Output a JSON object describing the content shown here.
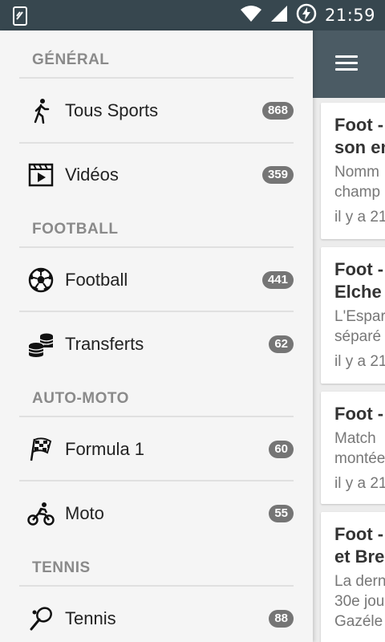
{
  "status_bar": {
    "time": "21:59"
  },
  "drawer": {
    "sections": [
      {
        "title": "GÉNÉRAL",
        "items": [
          {
            "label": "Tous Sports",
            "count": "868",
            "icon": "walking-person-icon"
          },
          {
            "label": "Vidéos",
            "count": "359",
            "icon": "video-play-icon"
          }
        ]
      },
      {
        "title": "FOOTBALL",
        "items": [
          {
            "label": "Football",
            "count": "441",
            "icon": "soccer-ball-icon"
          },
          {
            "label": "Transferts",
            "count": "62",
            "icon": "coins-icon"
          }
        ]
      },
      {
        "title": "AUTO-MOTO",
        "items": [
          {
            "label": "Formula 1",
            "count": "60",
            "icon": "checkered-flag-icon"
          },
          {
            "label": "Moto",
            "count": "55",
            "icon": "motorbike-icon"
          }
        ]
      },
      {
        "title": "TENNIS",
        "items": [
          {
            "label": "Tennis",
            "count": "88",
            "icon": "tennis-racket-icon"
          }
        ]
      }
    ]
  },
  "feed": {
    "cards": [
      {
        "title1": "Foot -",
        "title2": "son en",
        "text1": "Nomm",
        "text2": "champ",
        "time": "il y a 21"
      },
      {
        "title1": "Foot -",
        "title2": "Elche",
        "text1": "L'Espar",
        "text2": "séparé",
        "time": "il y a 21"
      },
      {
        "title1": "Foot -",
        "text1": "Match",
        "text2": "montée",
        "time": "il y a 21"
      },
      {
        "title1": "Foot -",
        "title2": "et Bre",
        "text1": "La dern",
        "text2": "30e jou",
        "text3": "Gazéle"
      }
    ]
  }
}
